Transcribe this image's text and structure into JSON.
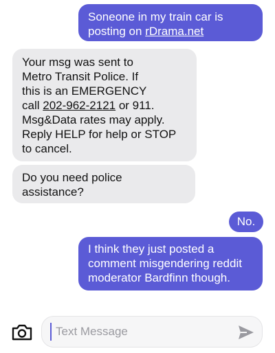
{
  "messages": [
    {
      "direction": "outgoing",
      "lines": [
        "Soneone in my train car is",
        "posting on "
      ],
      "link": "rDrama.net"
    },
    {
      "direction": "incoming",
      "lines": [
        "Your msg was sent to",
        "Metro Transit Police. If",
        "this is an EMERGENCY",
        "call "
      ],
      "phone": "202-962-2121",
      "after_phone": " or 911.",
      "lines2": [
        "Msg&Data rates may apply.",
        "Reply HELP for help or STOP",
        "to cancel."
      ]
    },
    {
      "direction": "incoming",
      "lines": [
        "Do you need police",
        "assistance?"
      ]
    },
    {
      "direction": "outgoing",
      "lines": [
        "No."
      ]
    },
    {
      "direction": "outgoing",
      "lines": [
        "I think they just posted a",
        "comment misgendering reddit",
        "moderator Bardfinn though."
      ]
    }
  ],
  "composer": {
    "placeholder": "Text Message",
    "camera_icon": "camera-icon",
    "send_icon": "send-icon"
  },
  "colors": {
    "outgoing_bubble": "#5b5bd6",
    "incoming_bubble": "#eaeaec"
  }
}
